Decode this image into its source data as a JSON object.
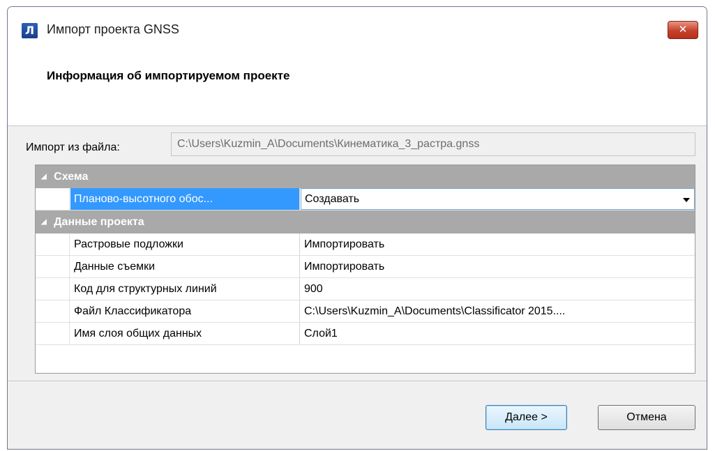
{
  "window": {
    "app_icon_glyph": "Л",
    "title": "Импорт проекта GNSS",
    "close_glyph": "✕"
  },
  "header": {
    "title": "Информация об импортируемом проекте"
  },
  "file": {
    "label": "Импорт из файла:",
    "value": "C:\\Users\\Kuzmin_A\\Documents\\Кинематика_3_растра.gnss"
  },
  "grid": {
    "categories": [
      {
        "label": "Схема",
        "rows": [
          {
            "name": "Планово-высотного обос...",
            "value": "Создавать"
          }
        ]
      },
      {
        "label": "Данные проекта",
        "rows": [
          {
            "name": "Растровые подложки",
            "value": "Импортировать"
          },
          {
            "name": "Данные съемки",
            "value": "Импортировать"
          },
          {
            "name": "Код для структурных линий",
            "value": "900"
          },
          {
            "name": "Файл Классификатора",
            "value": "C:\\Users\\Kuzmin_A\\Documents\\Classificator 2015...."
          },
          {
            "name": "Имя слоя общих данных",
            "value": "Слой1"
          }
        ]
      }
    ],
    "collapse_glyph": "◢"
  },
  "buttons": {
    "next": "Далее >",
    "cancel": "Отмена"
  }
}
